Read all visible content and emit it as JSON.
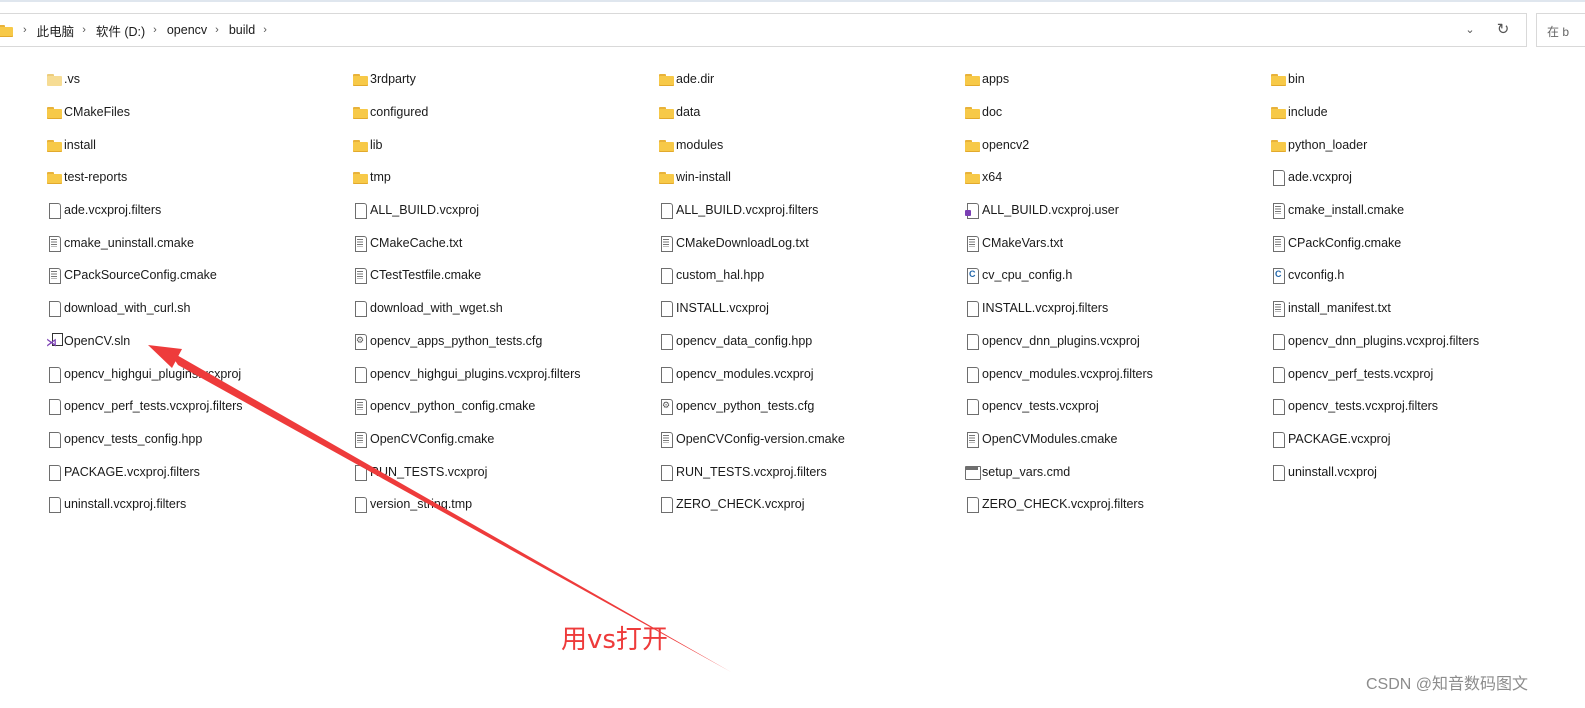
{
  "breadcrumb": [
    "此电脑",
    "软件 (D:)",
    "opencv",
    "build"
  ],
  "search_placeholder": "在 b",
  "items": [
    {
      "name": ".vs",
      "icon": "folder-faded-icon"
    },
    {
      "name": "3rdparty",
      "icon": "folder-icon"
    },
    {
      "name": "ade.dir",
      "icon": "folder-icon"
    },
    {
      "name": "apps",
      "icon": "folder-icon"
    },
    {
      "name": "bin",
      "icon": "folder-icon"
    },
    {
      "name": "CMakeFiles",
      "icon": "folder-icon"
    },
    {
      "name": "configured",
      "icon": "folder-icon"
    },
    {
      "name": "data",
      "icon": "folder-icon"
    },
    {
      "name": "doc",
      "icon": "folder-icon"
    },
    {
      "name": "include",
      "icon": "folder-icon"
    },
    {
      "name": "install",
      "icon": "folder-icon"
    },
    {
      "name": "lib",
      "icon": "folder-icon"
    },
    {
      "name": "modules",
      "icon": "folder-icon"
    },
    {
      "name": "opencv2",
      "icon": "folder-icon"
    },
    {
      "name": "python_loader",
      "icon": "folder-icon"
    },
    {
      "name": "test-reports",
      "icon": "folder-icon"
    },
    {
      "name": "tmp",
      "icon": "folder-icon"
    },
    {
      "name": "win-install",
      "icon": "folder-icon"
    },
    {
      "name": "x64",
      "icon": "folder-icon"
    },
    {
      "name": "ade.vcxproj",
      "icon": "file-icon"
    },
    {
      "name": "ade.vcxproj.filters",
      "icon": "file-icon"
    },
    {
      "name": "ALL_BUILD.vcxproj",
      "icon": "file-icon"
    },
    {
      "name": "ALL_BUILD.vcxproj.filters",
      "icon": "file-icon"
    },
    {
      "name": "ALL_BUILD.vcxproj.user",
      "icon": "vs-user-file-icon"
    },
    {
      "name": "cmake_install.cmake",
      "icon": "text-file-icon"
    },
    {
      "name": "cmake_uninstall.cmake",
      "icon": "text-file-icon"
    },
    {
      "name": "CMakeCache.txt",
      "icon": "text-file-icon"
    },
    {
      "name": "CMakeDownloadLog.txt",
      "icon": "text-file-icon"
    },
    {
      "name": "CMakeVars.txt",
      "icon": "text-file-icon"
    },
    {
      "name": "CPackConfig.cmake",
      "icon": "text-file-icon"
    },
    {
      "name": "CPackSourceConfig.cmake",
      "icon": "text-file-icon"
    },
    {
      "name": "CTestTestfile.cmake",
      "icon": "text-file-icon"
    },
    {
      "name": "custom_hal.hpp",
      "icon": "file-icon"
    },
    {
      "name": "cv_cpu_config.h",
      "icon": "c-header-file-icon"
    },
    {
      "name": "cvconfig.h",
      "icon": "c-header-file-icon"
    },
    {
      "name": "download_with_curl.sh",
      "icon": "file-icon"
    },
    {
      "name": "download_with_wget.sh",
      "icon": "file-icon"
    },
    {
      "name": "INSTALL.vcxproj",
      "icon": "file-icon"
    },
    {
      "name": "INSTALL.vcxproj.filters",
      "icon": "file-icon"
    },
    {
      "name": "install_manifest.txt",
      "icon": "text-file-icon"
    },
    {
      "name": "OpenCV.sln",
      "icon": "vs-solution-icon"
    },
    {
      "name": "opencv_apps_python_tests.cfg",
      "icon": "config-file-icon"
    },
    {
      "name": "opencv_data_config.hpp",
      "icon": "file-icon"
    },
    {
      "name": "opencv_dnn_plugins.vcxproj",
      "icon": "file-icon"
    },
    {
      "name": "opencv_dnn_plugins.vcxproj.filters",
      "icon": "file-icon"
    },
    {
      "name": "opencv_highgui_plugins.vcxproj",
      "icon": "file-icon"
    },
    {
      "name": "opencv_highgui_plugins.vcxproj.filters",
      "icon": "file-icon"
    },
    {
      "name": "opencv_modules.vcxproj",
      "icon": "file-icon"
    },
    {
      "name": "opencv_modules.vcxproj.filters",
      "icon": "file-icon"
    },
    {
      "name": "opencv_perf_tests.vcxproj",
      "icon": "file-icon"
    },
    {
      "name": "opencv_perf_tests.vcxproj.filters",
      "icon": "file-icon"
    },
    {
      "name": "opencv_python_config.cmake",
      "icon": "text-file-icon"
    },
    {
      "name": "opencv_python_tests.cfg",
      "icon": "config-file-icon"
    },
    {
      "name": "opencv_tests.vcxproj",
      "icon": "file-icon"
    },
    {
      "name": "opencv_tests.vcxproj.filters",
      "icon": "file-icon"
    },
    {
      "name": "opencv_tests_config.hpp",
      "icon": "file-icon"
    },
    {
      "name": "OpenCVConfig.cmake",
      "icon": "text-file-icon"
    },
    {
      "name": "OpenCVConfig-version.cmake",
      "icon": "text-file-icon"
    },
    {
      "name": "OpenCVModules.cmake",
      "icon": "text-file-icon"
    },
    {
      "name": "PACKAGE.vcxproj",
      "icon": "file-icon"
    },
    {
      "name": "PACKAGE.vcxproj.filters",
      "icon": "file-icon"
    },
    {
      "name": "RUN_TESTS.vcxproj",
      "icon": "file-icon"
    },
    {
      "name": "RUN_TESTS.vcxproj.filters",
      "icon": "file-icon"
    },
    {
      "name": "setup_vars.cmd",
      "icon": "cmd-file-icon"
    },
    {
      "name": "uninstall.vcxproj",
      "icon": "file-icon"
    },
    {
      "name": "uninstall.vcxproj.filters",
      "icon": "file-icon"
    },
    {
      "name": "version_string.tmp",
      "icon": "file-icon"
    },
    {
      "name": "ZERO_CHECK.vcxproj",
      "icon": "file-icon"
    },
    {
      "name": "ZERO_CHECK.vcxproj.filters",
      "icon": "file-icon"
    }
  ],
  "annotation": {
    "text": "用vs打开",
    "color": "#ee3b3b"
  },
  "watermark": "CSDN @知音数码图文"
}
